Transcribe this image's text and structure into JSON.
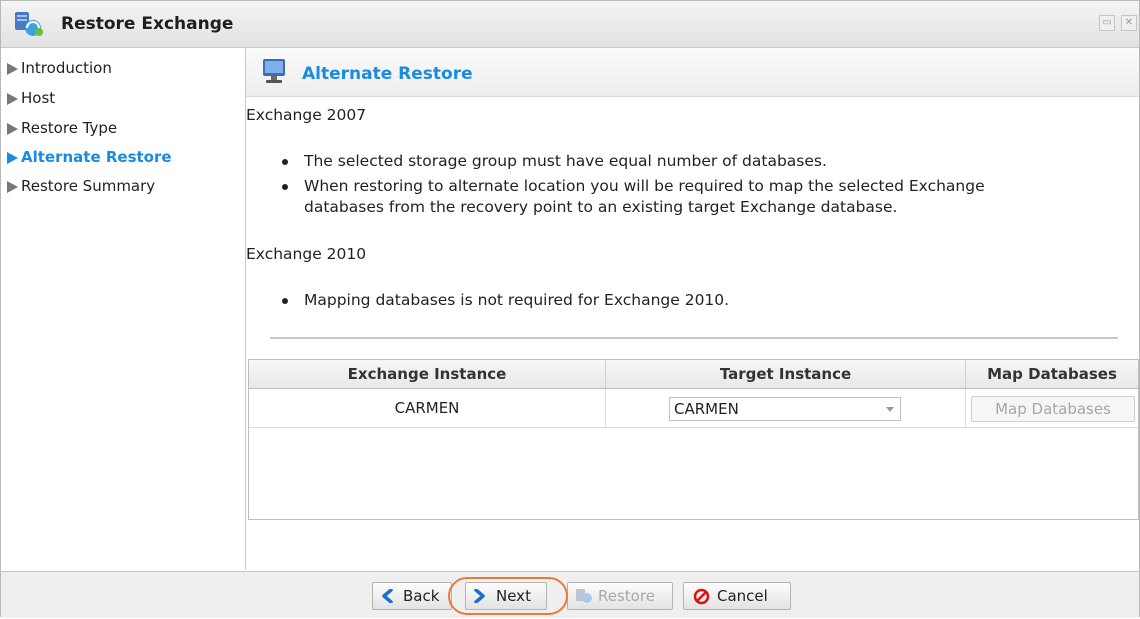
{
  "window": {
    "title": "Restore Exchange",
    "title_icon": "exchange-restore-icon"
  },
  "sidebar": {
    "items": [
      {
        "label": "Introduction",
        "active": false
      },
      {
        "label": "Host",
        "active": false
      },
      {
        "label": "Restore Type",
        "active": false
      },
      {
        "label": "Alternate Restore",
        "active": true
      },
      {
        "label": "Restore Summary",
        "active": false
      }
    ]
  },
  "main": {
    "section_title": "Alternate Restore",
    "section_icon": "monitor-icon",
    "exchange2007": {
      "heading": "Exchange 2007",
      "bullets": [
        "The selected storage group must have equal number of databases.",
        "When restoring to alternate location you will be required to map the selected Exchange",
        "databases from the recovery point to an existing target Exchange database."
      ]
    },
    "exchange2010": {
      "heading": "Exchange 2010",
      "bullets": [
        "Mapping databases is not required for Exchange 2010."
      ]
    },
    "grid": {
      "columns": [
        "Exchange Instance",
        "Target Instance",
        "Map Databases"
      ],
      "rows": [
        {
          "exchange_instance": "CARMEN",
          "target_instance": "CARMEN",
          "map_button": "Map Databases"
        }
      ]
    }
  },
  "footer": {
    "back": "Back",
    "next": "Next",
    "restore": "Restore",
    "cancel": "Cancel"
  },
  "colors": {
    "accent": "#1a8ce0",
    "highlight": "#e87a3a"
  }
}
